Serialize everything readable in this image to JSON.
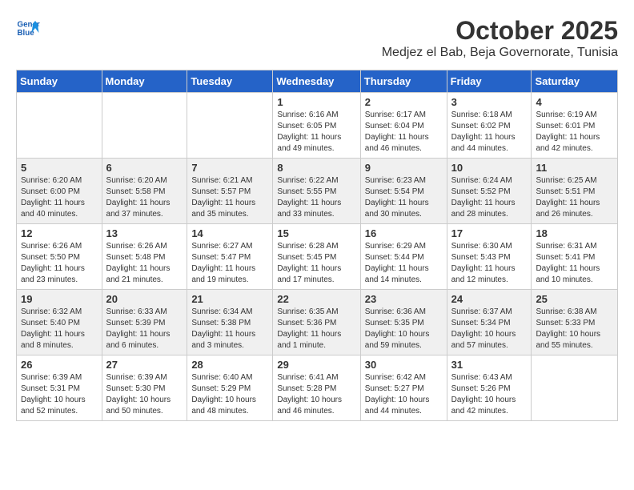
{
  "header": {
    "logo_line1": "General",
    "logo_line2": "Blue",
    "month_title": "October 2025",
    "subtitle": "Medjez el Bab, Beja Governorate, Tunisia"
  },
  "weekdays": [
    "Sunday",
    "Monday",
    "Tuesday",
    "Wednesday",
    "Thursday",
    "Friday",
    "Saturday"
  ],
  "weeks": [
    [
      {
        "day": "",
        "info": ""
      },
      {
        "day": "",
        "info": ""
      },
      {
        "day": "",
        "info": ""
      },
      {
        "day": "1",
        "info": "Sunrise: 6:16 AM\nSunset: 6:05 PM\nDaylight: 11 hours and 49 minutes."
      },
      {
        "day": "2",
        "info": "Sunrise: 6:17 AM\nSunset: 6:04 PM\nDaylight: 11 hours and 46 minutes."
      },
      {
        "day": "3",
        "info": "Sunrise: 6:18 AM\nSunset: 6:02 PM\nDaylight: 11 hours and 44 minutes."
      },
      {
        "day": "4",
        "info": "Sunrise: 6:19 AM\nSunset: 6:01 PM\nDaylight: 11 hours and 42 minutes."
      }
    ],
    [
      {
        "day": "5",
        "info": "Sunrise: 6:20 AM\nSunset: 6:00 PM\nDaylight: 11 hours and 40 minutes."
      },
      {
        "day": "6",
        "info": "Sunrise: 6:20 AM\nSunset: 5:58 PM\nDaylight: 11 hours and 37 minutes."
      },
      {
        "day": "7",
        "info": "Sunrise: 6:21 AM\nSunset: 5:57 PM\nDaylight: 11 hours and 35 minutes."
      },
      {
        "day": "8",
        "info": "Sunrise: 6:22 AM\nSunset: 5:55 PM\nDaylight: 11 hours and 33 minutes."
      },
      {
        "day": "9",
        "info": "Sunrise: 6:23 AM\nSunset: 5:54 PM\nDaylight: 11 hours and 30 minutes."
      },
      {
        "day": "10",
        "info": "Sunrise: 6:24 AM\nSunset: 5:52 PM\nDaylight: 11 hours and 28 minutes."
      },
      {
        "day": "11",
        "info": "Sunrise: 6:25 AM\nSunset: 5:51 PM\nDaylight: 11 hours and 26 minutes."
      }
    ],
    [
      {
        "day": "12",
        "info": "Sunrise: 6:26 AM\nSunset: 5:50 PM\nDaylight: 11 hours and 23 minutes."
      },
      {
        "day": "13",
        "info": "Sunrise: 6:26 AM\nSunset: 5:48 PM\nDaylight: 11 hours and 21 minutes."
      },
      {
        "day": "14",
        "info": "Sunrise: 6:27 AM\nSunset: 5:47 PM\nDaylight: 11 hours and 19 minutes."
      },
      {
        "day": "15",
        "info": "Sunrise: 6:28 AM\nSunset: 5:45 PM\nDaylight: 11 hours and 17 minutes."
      },
      {
        "day": "16",
        "info": "Sunrise: 6:29 AM\nSunset: 5:44 PM\nDaylight: 11 hours and 14 minutes."
      },
      {
        "day": "17",
        "info": "Sunrise: 6:30 AM\nSunset: 5:43 PM\nDaylight: 11 hours and 12 minutes."
      },
      {
        "day": "18",
        "info": "Sunrise: 6:31 AM\nSunset: 5:41 PM\nDaylight: 11 hours and 10 minutes."
      }
    ],
    [
      {
        "day": "19",
        "info": "Sunrise: 6:32 AM\nSunset: 5:40 PM\nDaylight: 11 hours and 8 minutes."
      },
      {
        "day": "20",
        "info": "Sunrise: 6:33 AM\nSunset: 5:39 PM\nDaylight: 11 hours and 6 minutes."
      },
      {
        "day": "21",
        "info": "Sunrise: 6:34 AM\nSunset: 5:38 PM\nDaylight: 11 hours and 3 minutes."
      },
      {
        "day": "22",
        "info": "Sunrise: 6:35 AM\nSunset: 5:36 PM\nDaylight: 11 hours and 1 minute."
      },
      {
        "day": "23",
        "info": "Sunrise: 6:36 AM\nSunset: 5:35 PM\nDaylight: 10 hours and 59 minutes."
      },
      {
        "day": "24",
        "info": "Sunrise: 6:37 AM\nSunset: 5:34 PM\nDaylight: 10 hours and 57 minutes."
      },
      {
        "day": "25",
        "info": "Sunrise: 6:38 AM\nSunset: 5:33 PM\nDaylight: 10 hours and 55 minutes."
      }
    ],
    [
      {
        "day": "26",
        "info": "Sunrise: 6:39 AM\nSunset: 5:31 PM\nDaylight: 10 hours and 52 minutes."
      },
      {
        "day": "27",
        "info": "Sunrise: 6:39 AM\nSunset: 5:30 PM\nDaylight: 10 hours and 50 minutes."
      },
      {
        "day": "28",
        "info": "Sunrise: 6:40 AM\nSunset: 5:29 PM\nDaylight: 10 hours and 48 minutes."
      },
      {
        "day": "29",
        "info": "Sunrise: 6:41 AM\nSunset: 5:28 PM\nDaylight: 10 hours and 46 minutes."
      },
      {
        "day": "30",
        "info": "Sunrise: 6:42 AM\nSunset: 5:27 PM\nDaylight: 10 hours and 44 minutes."
      },
      {
        "day": "31",
        "info": "Sunrise: 6:43 AM\nSunset: 5:26 PM\nDaylight: 10 hours and 42 minutes."
      },
      {
        "day": "",
        "info": ""
      }
    ]
  ]
}
